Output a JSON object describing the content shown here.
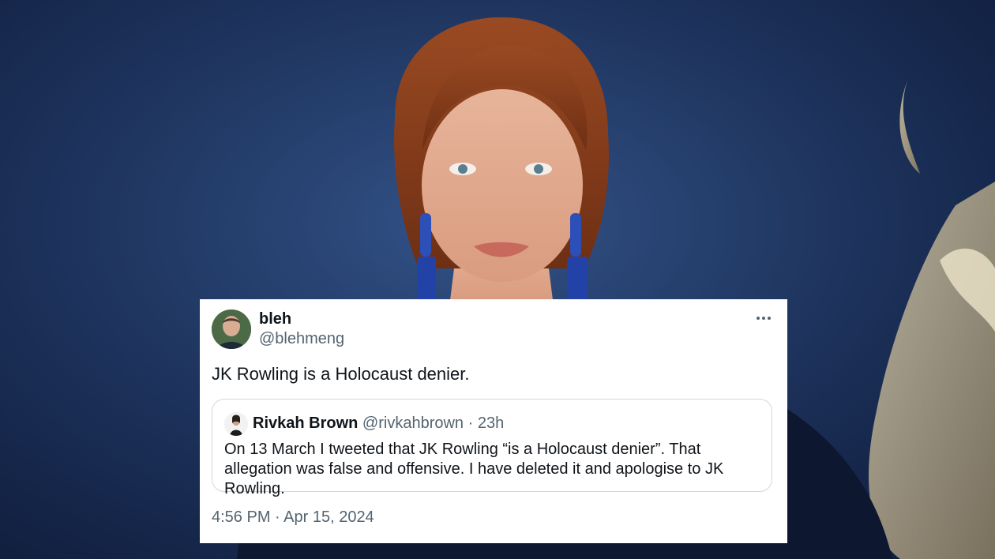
{
  "tweet": {
    "display_name": "bleh",
    "handle": "@blehmeng",
    "text": "JK Rowling is a Holocaust denier.",
    "timestamp": "4:56 PM · Apr 15, 2024",
    "more_icon": "more-horizontal-icon"
  },
  "quoted_tweet": {
    "display_name": "Rivkah Brown",
    "handle_time": "@rivkahbrown · 23h",
    "text": "On 13 March I tweeted that JK Rowling “is a Holocaust denier”. That allegation was false and offensive. I have deleted it and apologise to JK Rowling."
  },
  "colors": {
    "background": "#1f355f",
    "card": "#ffffff",
    "text_primary": "#0f1419",
    "text_secondary": "#536471",
    "border": "#cfd9de"
  }
}
